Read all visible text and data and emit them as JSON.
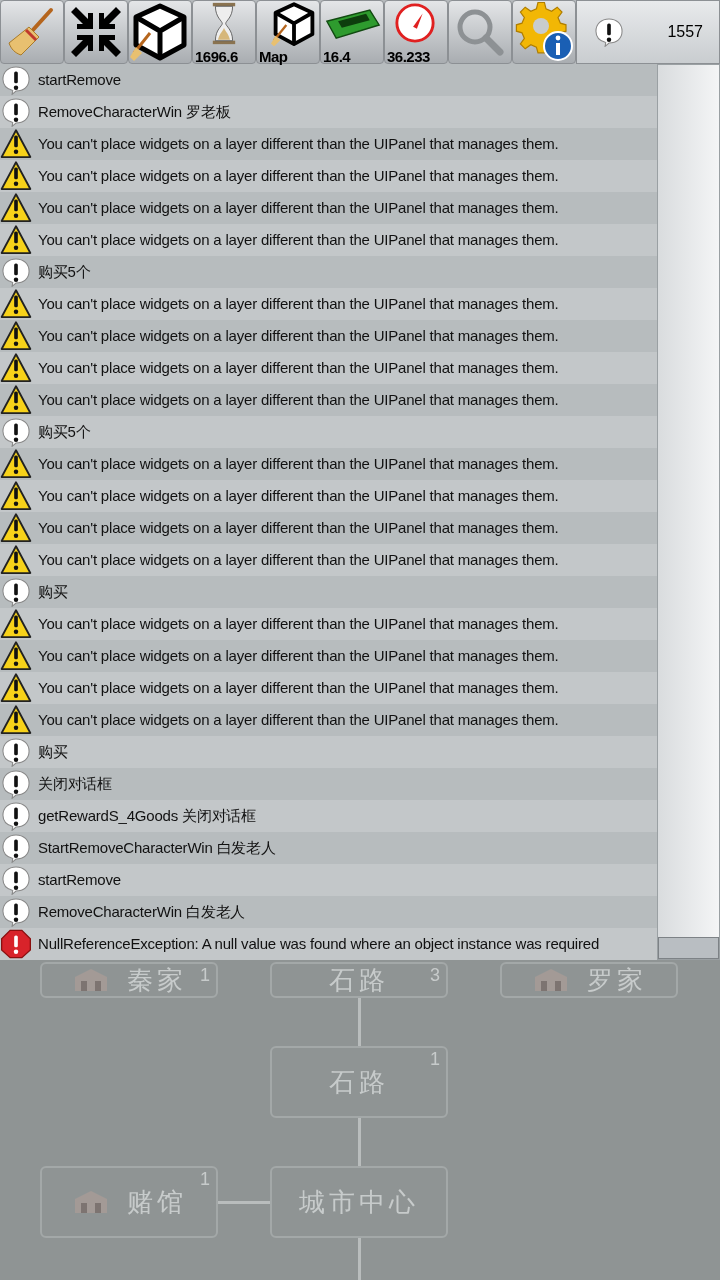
{
  "toolbar": {
    "timer": "1696.6",
    "scene": "Map",
    "memory": "16.4",
    "fps": "36.233",
    "log_count": "1557"
  },
  "log": [
    {
      "kind": "info",
      "text": "startRemove"
    },
    {
      "kind": "info",
      "text": "RemoveCharacterWin 罗老板"
    },
    {
      "kind": "warning",
      "text": "You can't place widgets on a layer different than the UIPanel that manages them."
    },
    {
      "kind": "warning",
      "text": "You can't place widgets on a layer different than the UIPanel that manages them."
    },
    {
      "kind": "warning",
      "text": "You can't place widgets on a layer different than the UIPanel that manages them."
    },
    {
      "kind": "warning",
      "text": "You can't place widgets on a layer different than the UIPanel that manages them."
    },
    {
      "kind": "info",
      "text": "购买5个"
    },
    {
      "kind": "warning",
      "text": "You can't place widgets on a layer different than the UIPanel that manages them."
    },
    {
      "kind": "warning",
      "text": "You can't place widgets on a layer different than the UIPanel that manages them."
    },
    {
      "kind": "warning",
      "text": "You can't place widgets on a layer different than the UIPanel that manages them."
    },
    {
      "kind": "warning",
      "text": "You can't place widgets on a layer different than the UIPanel that manages them."
    },
    {
      "kind": "info",
      "text": "购买5个"
    },
    {
      "kind": "warning",
      "text": "You can't place widgets on a layer different than the UIPanel that manages them."
    },
    {
      "kind": "warning",
      "text": "You can't place widgets on a layer different than the UIPanel that manages them."
    },
    {
      "kind": "warning",
      "text": "You can't place widgets on a layer different than the UIPanel that manages them."
    },
    {
      "kind": "warning",
      "text": "You can't place widgets on a layer different than the UIPanel that manages them."
    },
    {
      "kind": "info",
      "text": "购买"
    },
    {
      "kind": "warning",
      "text": "You can't place widgets on a layer different than the UIPanel that manages them."
    },
    {
      "kind": "warning",
      "text": "You can't place widgets on a layer different than the UIPanel that manages them."
    },
    {
      "kind": "warning",
      "text": "You can't place widgets on a layer different than the UIPanel that manages them."
    },
    {
      "kind": "warning",
      "text": "You can't place widgets on a layer different than the UIPanel that manages them."
    },
    {
      "kind": "info",
      "text": "购买"
    },
    {
      "kind": "info",
      "text": "关闭对话框"
    },
    {
      "kind": "info",
      "text": "getRewardS_4Goods 关闭对话框"
    },
    {
      "kind": "info",
      "text": "StartRemoveCharacterWin 白发老人"
    },
    {
      "kind": "info",
      "text": "startRemove"
    },
    {
      "kind": "info",
      "text": "RemoveCharacterWin 白发老人"
    },
    {
      "kind": "error",
      "text": "NullReferenceException: A null value was found where an object instance was required"
    }
  ],
  "map": {
    "top_row": [
      {
        "label": "秦家",
        "count": "1"
      },
      {
        "label": "石路",
        "count": "3"
      },
      {
        "label": "罗家"
      }
    ],
    "middle": {
      "label": "石路",
      "count": "1"
    },
    "bottom_left": {
      "label": "赌馆",
      "count": "1"
    },
    "bottom_center": {
      "label": "城市中心"
    }
  }
}
